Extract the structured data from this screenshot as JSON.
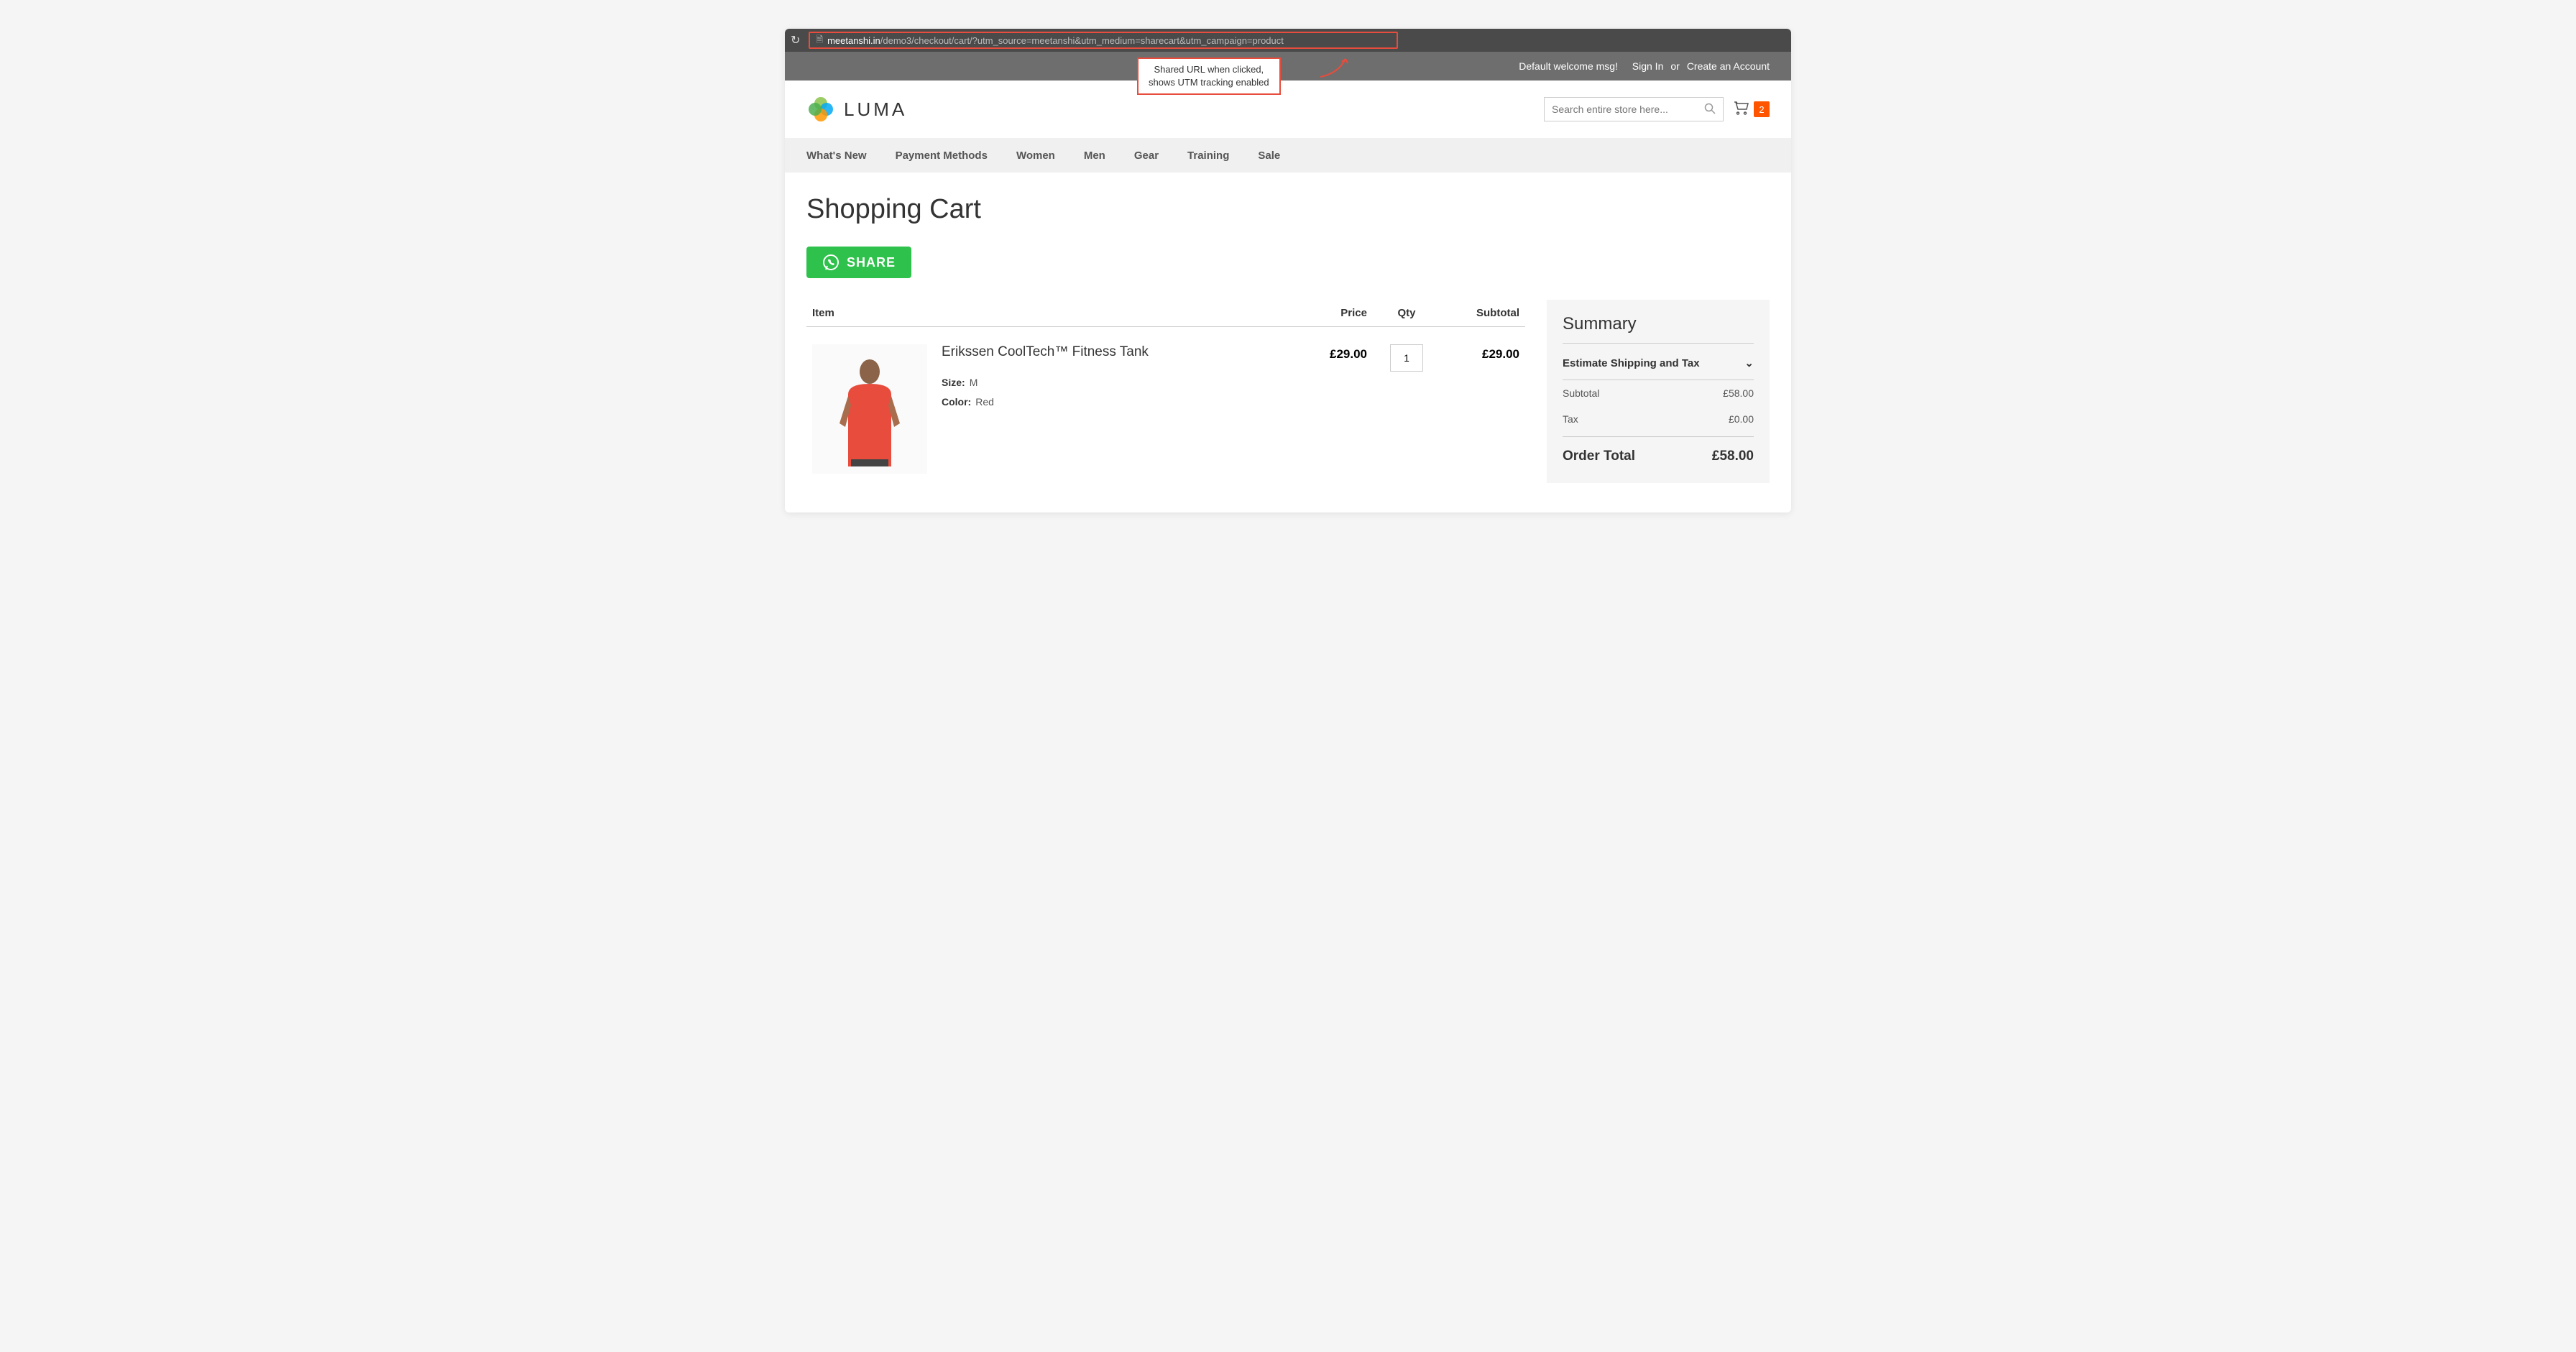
{
  "browser": {
    "url_domain": "meetanshi.in",
    "url_path": "/demo3/checkout/cart/?utm_source=meetanshi&utm_medium=sharecart&utm_campaign=product"
  },
  "annotation": {
    "line1": "Shared URL when clicked,",
    "line2": "shows UTM tracking enabled"
  },
  "topbar": {
    "welcome": "Default welcome msg!",
    "signin": "Sign In",
    "or": "or",
    "create": "Create an Account"
  },
  "header": {
    "brand": "LUMA",
    "search_placeholder": "Search entire store here...",
    "cart_count": "2"
  },
  "nav": {
    "items": [
      "What's New",
      "Payment Methods",
      "Women",
      "Men",
      "Gear",
      "Training",
      "Sale"
    ]
  },
  "page": {
    "title": "Shopping Cart",
    "share_label": "SHARE"
  },
  "table": {
    "headers": {
      "item": "Item",
      "price": "Price",
      "qty": "Qty",
      "subtotal": "Subtotal"
    },
    "row": {
      "name": "Erikssen CoolTech™ Fitness Tank",
      "size_label": "Size:",
      "size_value": "M",
      "color_label": "Color:",
      "color_value": "Red",
      "price": "£29.00",
      "qty": "1",
      "subtotal": "£29.00"
    }
  },
  "summary": {
    "title": "Summary",
    "estimate": "Estimate Shipping and Tax",
    "subtotal_label": "Subtotal",
    "subtotal_value": "£58.00",
    "tax_label": "Tax",
    "tax_value": "£0.00",
    "total_label": "Order Total",
    "total_value": "£58.00"
  }
}
